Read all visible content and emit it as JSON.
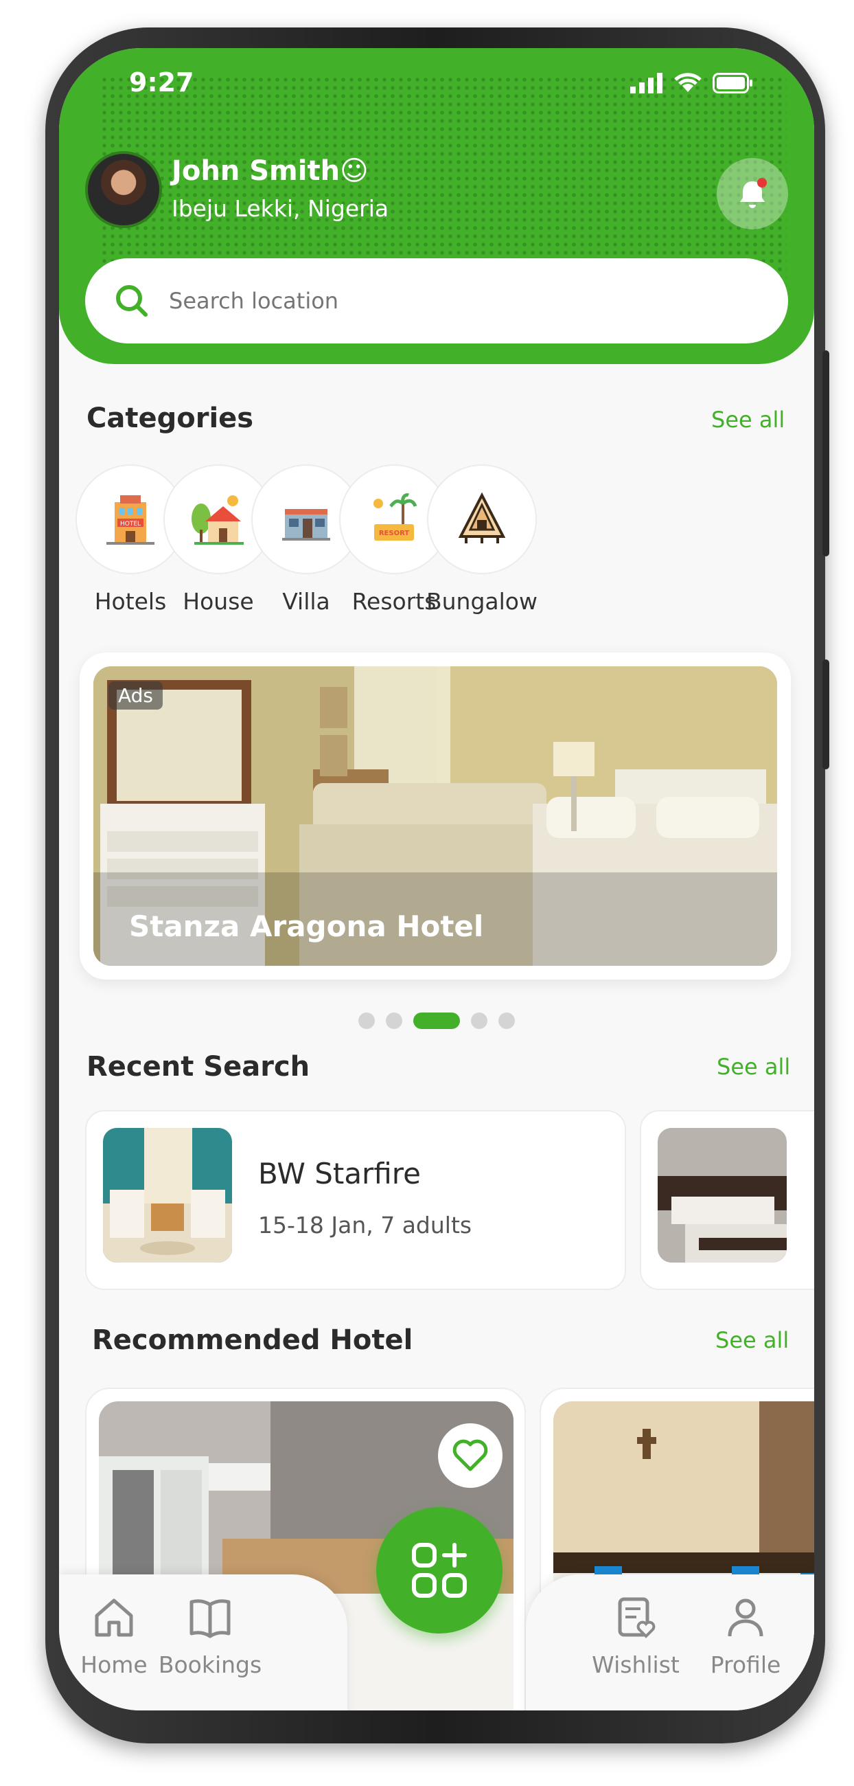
{
  "status": {
    "time": "9:27"
  },
  "user": {
    "name": "John Smith☺",
    "location": "Ibeju Lekki, Nigeria"
  },
  "search": {
    "placeholder": "Search location"
  },
  "categories": {
    "title": "Categories",
    "see_all": "See all",
    "items": [
      {
        "label": "Hotels",
        "icon": "hotel-icon"
      },
      {
        "label": "House",
        "icon": "house-icon"
      },
      {
        "label": "Villa",
        "icon": "villa-icon"
      },
      {
        "label": "Resorts",
        "icon": "resort-icon"
      },
      {
        "label": "Bungalow",
        "icon": "bungalow-icon"
      }
    ]
  },
  "ad": {
    "badge": "Ads",
    "title": "Stanza Aragona Hotel",
    "resort_sign": "RESORT"
  },
  "carousel": {
    "count": 5,
    "active_index": 2
  },
  "recent": {
    "title": "Recent Search",
    "see_all": "See all",
    "items": [
      {
        "name": "BW Starfire",
        "info": "15-18 Jan, 7 adults"
      }
    ]
  },
  "recommended": {
    "title": "Recommended Hotel",
    "see_all": "See all"
  },
  "nav": {
    "home": "Home",
    "bookings": "Bookings",
    "wishlist": "Wishlist",
    "profile": "Profile"
  },
  "colors": {
    "accent": "#43b02a",
    "notification_dot": "#e53935"
  }
}
